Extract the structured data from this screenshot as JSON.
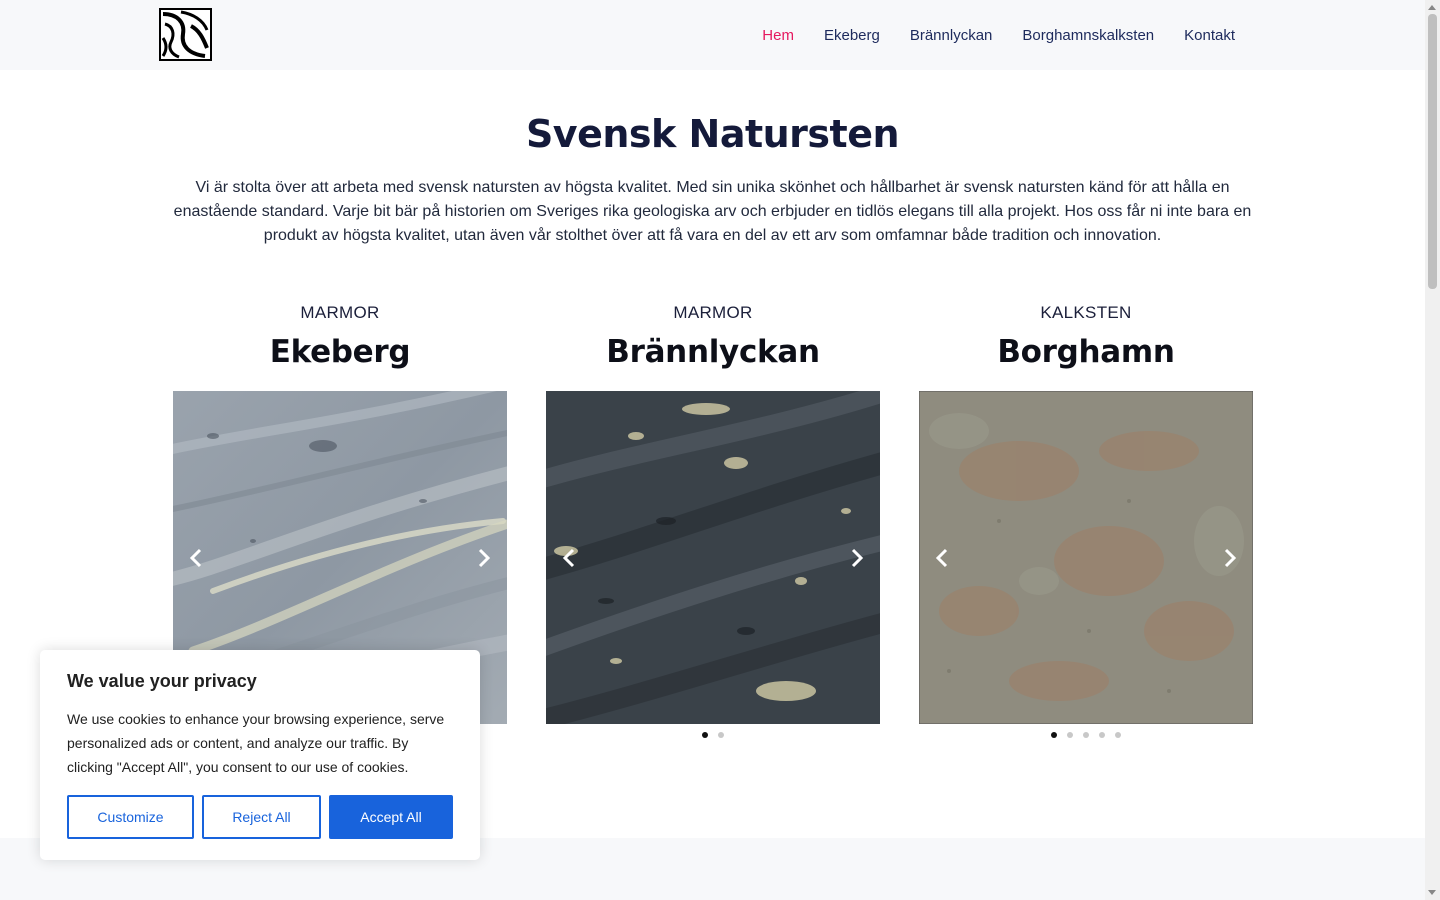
{
  "colors": {
    "accent": "#e5195f",
    "nav_text": "#1d2a5c",
    "cookie_blue": "#1863dc"
  },
  "nav": {
    "logo_icon": "abstract-stone-logo",
    "items": [
      {
        "label": "Hem",
        "active": true
      },
      {
        "label": "Ekeberg",
        "active": false
      },
      {
        "label": "Brännlyckan",
        "active": false
      },
      {
        "label": "Borghamnskalksten",
        "active": false
      },
      {
        "label": "Kontakt",
        "active": false
      }
    ]
  },
  "hero": {
    "title": "Svensk Natursten",
    "text": "Vi är stolta över att arbeta med svensk natursten av högsta kvalitet. Med sin unika skönhet och hållbarhet är svensk natursten känd för att hålla en enastående standard. Varje bit bär på historien om Sveriges rika geologiska arv och erbjuder en tidlös elegans till alla projekt. Hos oss får ni inte bara en produkt av högsta kvalitet, utan även vår stolthet över att få vara en del av ett arv som omfamnar både tradition och innovation."
  },
  "stones": [
    {
      "kind": "MARMOR",
      "name": "Ekeberg",
      "slides": 1,
      "active_slide": 0
    },
    {
      "kind": "MARMOR",
      "name": "Brännlyckan",
      "slides": 2,
      "active_slide": 0
    },
    {
      "kind": "KALKSTEN",
      "name": "Borghamn",
      "slides": 5,
      "active_slide": 0
    }
  ],
  "cookie": {
    "title": "We value your privacy",
    "text": "We use cookies to enhance your browsing experience, serve personalized ads or content, and analyze our traffic. By clicking \"Accept All\", you consent to our use of cookies.",
    "customize": "Customize",
    "reject": "Reject All",
    "accept": "Accept All"
  }
}
